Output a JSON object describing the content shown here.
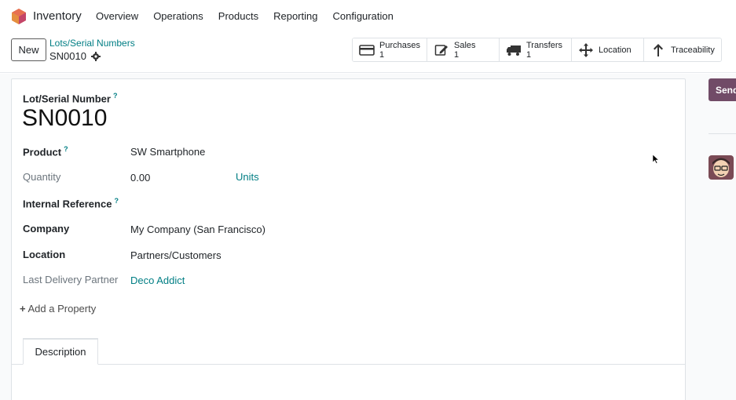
{
  "navbar": {
    "app_name": "Inventory",
    "menu": [
      "Overview",
      "Operations",
      "Products",
      "Reporting",
      "Configuration"
    ]
  },
  "control_panel": {
    "new_label": "New",
    "breadcrumb_parent": "Lots/Serial Numbers",
    "breadcrumb_current": "SN0010",
    "smart_buttons": {
      "purchases": {
        "label": "Purchases",
        "count": "1"
      },
      "sales": {
        "label": "Sales",
        "count": "1"
      },
      "transfers": {
        "label": "Transfers",
        "count": "1"
      },
      "location": {
        "label": "Location"
      },
      "traceability": {
        "label": "Traceability"
      }
    }
  },
  "form": {
    "title_label": "Lot/Serial Number",
    "title_value": "SN0010",
    "help_mark": "?",
    "product_label": "Product",
    "product_value": "SW Smartphone",
    "quantity_label": "Quantity",
    "quantity_value": "0.00",
    "quantity_unit": "Units",
    "internal_ref_label": "Internal Reference",
    "company_label": "Company",
    "company_value": "My Company (San Francisco)",
    "location_label": "Location",
    "location_value": "Partners/Customers",
    "last_partner_label": "Last Delivery Partner",
    "last_partner_value": "Deco Addict",
    "add_property": "Add a Property",
    "tab_description": "Description"
  },
  "chatter": {
    "send_label": "Send"
  },
  "colors": {
    "accent": "#017e84",
    "brand": "#714b67"
  }
}
